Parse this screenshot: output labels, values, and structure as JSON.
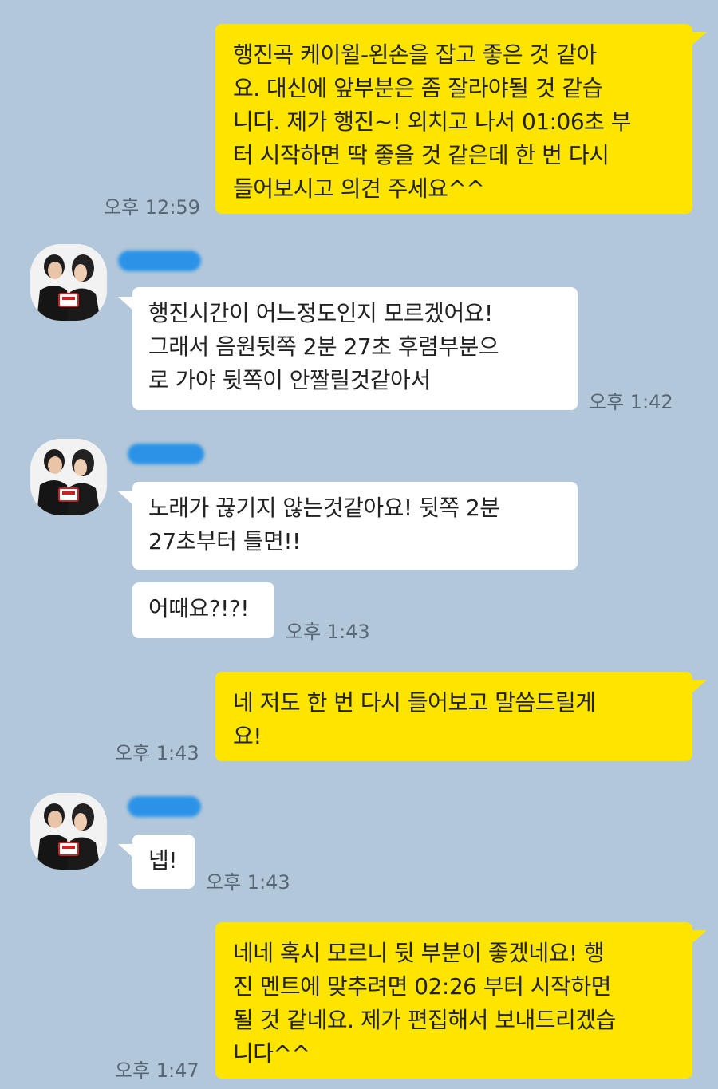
{
  "messages": [
    {
      "id": "m1",
      "side": "mine",
      "text": "행진곡 케이윌-왼손을 잡고 좋은 것 같아\n요. 대신에 앞부분은 좀 잘라야될 것 같습\n니다. 제가 행진~! 외치고 나서 01:06초 부\n터 시작하면 딱 좋을 것 같은데 한 번 다시\n 들어보시고 의견 주세요^^",
      "time": "오후 12:59"
    },
    {
      "id": "m2",
      "side": "theirs",
      "text": "행진시간이 어느정도인지 모르겠어요!\n그래서 음원뒷쪽 2분 27초 후렴부분으\n로 가야 뒷쪽이 안짤릴것같아서",
      "time": "오후 1:42"
    },
    {
      "id": "m3",
      "side": "theirs",
      "text": "노래가 끊기지 않는것같아요! 뒷쪽 2분\n 27초부터 틀면!!",
      "time": ""
    },
    {
      "id": "m4",
      "side": "theirs",
      "text": "어때요?!?!",
      "time": "오후 1:43"
    },
    {
      "id": "m5",
      "side": "mine",
      "text": "네 저도 한 번 다시 들어보고 말씀드릴게\n요!",
      "time": "오후 1:43"
    },
    {
      "id": "m6",
      "side": "theirs",
      "text": "넵!",
      "time": "오후 1:43"
    },
    {
      "id": "m7",
      "side": "mine",
      "text": "네네 혹시 모르니 뒷 부분이 좋겠네요! 행\n진 멘트에 맞추려면 02:26 부터 시작하면\n 될 것 같네요. 제가 편집해서 보내드리겠습\n니다^^",
      "time": "오후 1:47"
    }
  ],
  "colors": {
    "background": "#b2c7d9",
    "my_bubble": "#fee500",
    "their_bubble": "#ffffff",
    "name_redaction": "#2a93e8"
  },
  "icons": {
    "avatar": "profile-photo-couple"
  }
}
